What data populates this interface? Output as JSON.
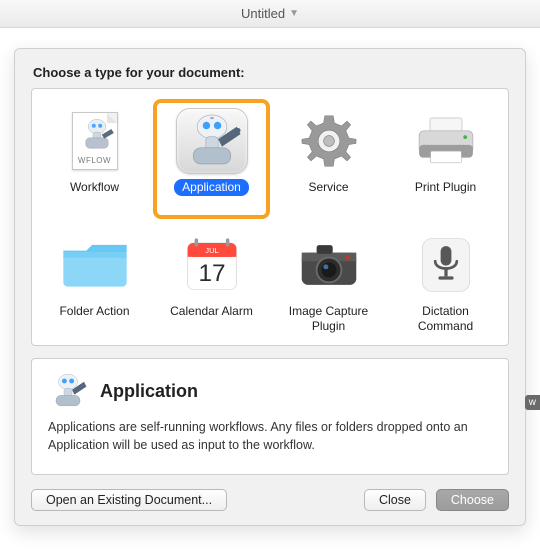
{
  "window": {
    "title": "Untitled"
  },
  "prompt": "Choose a type for your document:",
  "types": [
    {
      "label": "Workflow",
      "icon": "wflow",
      "file_tag": "WFLOW"
    },
    {
      "label": "Application",
      "icon": "app",
      "selected": true,
      "highlighted": true
    },
    {
      "label": "Service",
      "icon": "gear"
    },
    {
      "label": "Print Plugin",
      "icon": "printer"
    },
    {
      "label": "Folder Action",
      "icon": "folder"
    },
    {
      "label": "Calendar Alarm",
      "icon": "calendar",
      "cal_month": "JUL",
      "cal_day": "17"
    },
    {
      "label": "Image Capture Plugin",
      "icon": "camera"
    },
    {
      "label": "Dictation Command",
      "icon": "mic"
    }
  ],
  "detail": {
    "title": "Application",
    "text": "Applications are self-running workflows. Any files or folders dropped onto an Application will be used as input to the workflow."
  },
  "buttons": {
    "open_existing": "Open an Existing Document...",
    "close": "Close",
    "choose": "Choose"
  },
  "edge_tag": "w"
}
